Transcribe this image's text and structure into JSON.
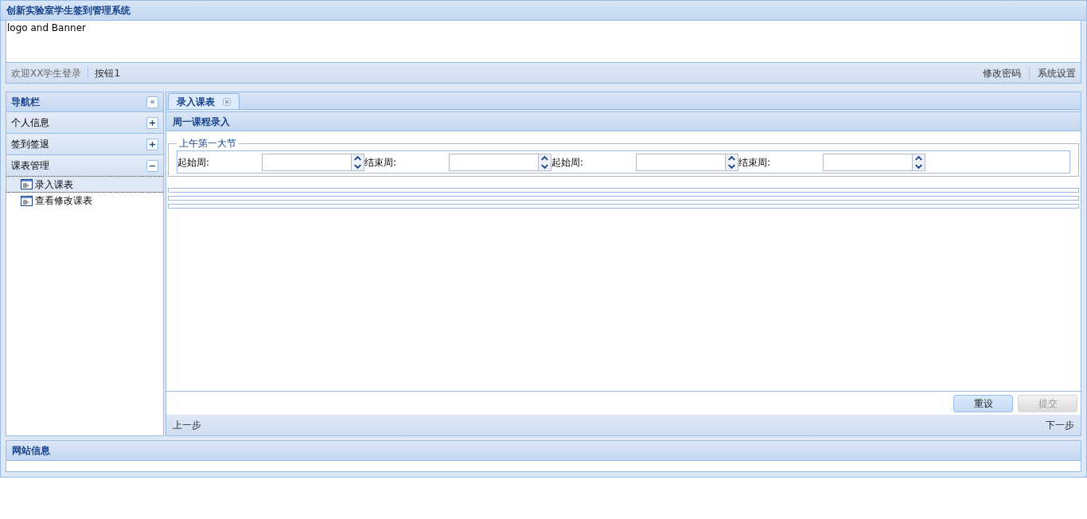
{
  "window": {
    "title": "创新实验室学生签到管理系统"
  },
  "banner": {
    "text": "logo and Banner"
  },
  "toolbar": {
    "left": [
      "欢迎XX学生登录",
      "按钮1"
    ],
    "right": [
      "修改密码",
      "系统设置"
    ]
  },
  "nav": {
    "title": "导航栏",
    "collapse_icon": "«",
    "sections": [
      {
        "label": "个人信息",
        "expanded": false
      },
      {
        "label": "签到签退",
        "expanded": false
      },
      {
        "label": "课表管理",
        "expanded": true,
        "children": [
          {
            "label": "录入课表",
            "selected": true
          },
          {
            "label": "查看修改课表",
            "selected": false
          }
        ]
      }
    ]
  },
  "tabs": [
    {
      "label": "录入课表",
      "selected": true
    }
  ],
  "form": {
    "title": "周一课程录入",
    "fieldset": {
      "legend": "上午第一大节",
      "fields": [
        {
          "label": "起始周:"
        },
        {
          "label": "结束周:"
        },
        {
          "label": "起始周:"
        },
        {
          "label": "结束周:"
        }
      ]
    },
    "buttons": [
      {
        "label": "重设",
        "disabled": false
      },
      {
        "label": "提交",
        "disabled": true
      }
    ]
  },
  "wizard": {
    "prev": "上一步",
    "next": "下一步"
  },
  "footer": {
    "title": "网站信息"
  }
}
